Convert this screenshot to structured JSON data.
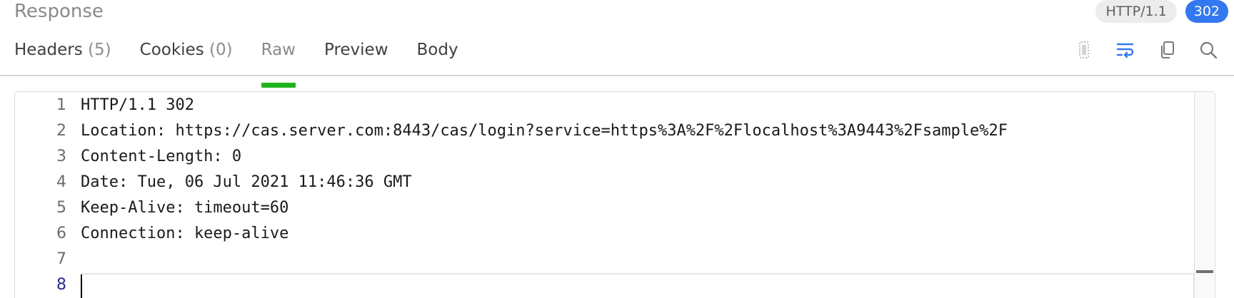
{
  "panel": {
    "title": "Response",
    "protocol_badge": "HTTP/1.1",
    "status_badge": "302"
  },
  "tabs": [
    {
      "label": "Headers",
      "count": "(5)",
      "active": false
    },
    {
      "label": "Cookies",
      "count": "(0)",
      "active": false
    },
    {
      "label": "Raw",
      "count": "",
      "active": true
    },
    {
      "label": "Preview",
      "count": "",
      "active": false
    },
    {
      "label": "Body",
      "count": "",
      "active": false
    }
  ],
  "toolbar": {
    "icons": [
      "format-icon",
      "wrap-lines-icon",
      "copy-icon",
      "search-icon"
    ],
    "active_icon": "wrap-lines-icon",
    "accent_color": "#3478f0"
  },
  "editor": {
    "lines": [
      {
        "num": "1",
        "text": "HTTP/1.1 302"
      },
      {
        "num": "2",
        "text": "Location: https://cas.server.com:8443/cas/login?service=https%3A%2F%2Flocalhost%3A9443%2Fsample%2F"
      },
      {
        "num": "3",
        "text": "Content-Length: 0"
      },
      {
        "num": "4",
        "text": "Date: Tue, 06 Jul 2021 11:46:36 GMT"
      },
      {
        "num": "5",
        "text": "Keep-Alive: timeout=60"
      },
      {
        "num": "6",
        "text": "Connection: keep-alive"
      },
      {
        "num": "7",
        "text": ""
      },
      {
        "num": "8",
        "text": ""
      }
    ],
    "current_line": "8"
  },
  "colors": {
    "active_tab_underline": "#1fb31f",
    "status_badge_bg": "#3478f0"
  }
}
